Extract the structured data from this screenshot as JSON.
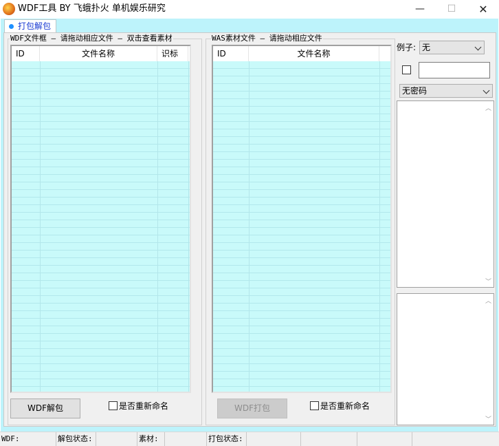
{
  "window": {
    "title": "WDF工具 BY 飞蛾扑火 单机娱乐研究",
    "minimize_glyph": "—",
    "maximize_glyph": "☐",
    "close_glyph": "✕"
  },
  "tabs": [
    {
      "label": "打包解包",
      "selected": true
    }
  ],
  "wdf_panel": {
    "label": "WDF文件框 — 请拖动相应文件 — 双击查看素材",
    "columns": [
      "ID",
      "文件名称",
      "识标"
    ],
    "rows": [],
    "unpack_button": "WDF解包",
    "rename_label": "是否重新命名",
    "rename_checked": false
  },
  "was_panel": {
    "label": "WAS素材文件   — 请拖动相应文件",
    "columns": [
      "ID",
      "文件名称"
    ],
    "rows": [],
    "pack_button": "WDF打包",
    "pack_enabled": false,
    "rename_label": "是否重新命名",
    "rename_checked": false
  },
  "side_panel": {
    "example_label": "例子:",
    "example_value": "无",
    "checkbox_checked": false,
    "text_value": "",
    "password_value": "无密码"
  },
  "statusbar": {
    "wdf_label": "WDF:",
    "unpack_status_label": "解包状态:",
    "material_label": "素材:",
    "pack_status_label": "打包状态:"
  },
  "colors": {
    "list_bg": "#c9fafa",
    "client_bg": "#bdf3fb",
    "tab_text": "#1a3ad2"
  }
}
